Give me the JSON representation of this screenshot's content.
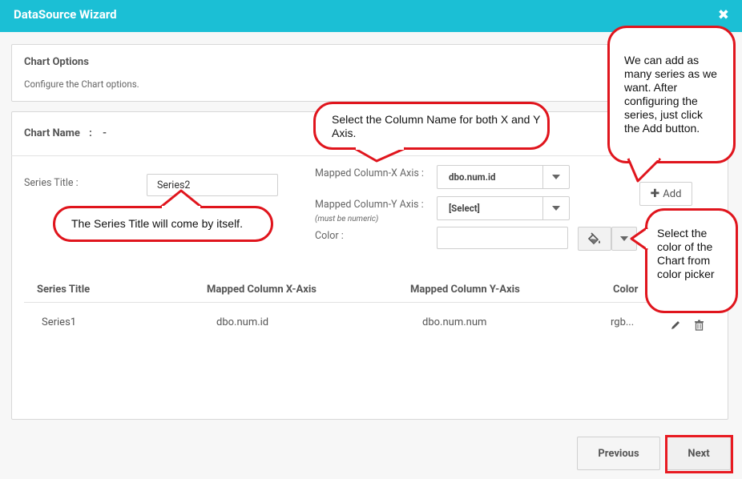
{
  "window": {
    "title": "DataSource Wizard",
    "close_glyph": "✖"
  },
  "chart_options": {
    "heading": "Chart Options",
    "description": "Configure the Chart options."
  },
  "chart_name": {
    "label": "Chart Name",
    "separator": ":",
    "value": "-"
  },
  "series_title": {
    "label": "Series Title :",
    "value": "Series2"
  },
  "mapped_x": {
    "label": "Mapped Column-X Axis :",
    "selected": "dbo.num.id"
  },
  "mapped_y": {
    "label": "Mapped Column-Y Axis :",
    "hint": "(must be numeric)",
    "selected": "[Select]"
  },
  "color": {
    "label": "Color :",
    "value": ""
  },
  "add_button": {
    "label": "Add"
  },
  "table": {
    "headers": [
      "Series Title",
      "Mapped Column X-Axis",
      "Mapped Column Y-Axis",
      "Color"
    ],
    "rows": [
      {
        "series_title": "Series1",
        "x_axis": "dbo.num.id",
        "y_axis": "dbo.num.num",
        "color": "rgb..."
      }
    ]
  },
  "footer": {
    "previous_label": "Previous",
    "next_label": "Next"
  },
  "callouts": {
    "add_series": "We can add as many series as we want. After configuring the series, just click the Add button.",
    "column_name": "Select the Column Name for both X and Y Axis.",
    "series_title": "The Series Title will come by itself.",
    "color_picker": "Select the color of the Chart from color picker"
  },
  "colors": {
    "header": "#1bbfd5",
    "callout_border": "#e0151d"
  }
}
